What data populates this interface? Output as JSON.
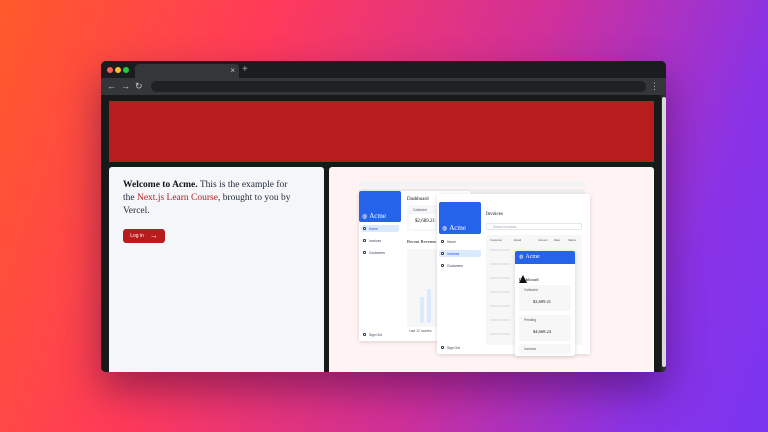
{
  "browser": {
    "tab_close": "×",
    "new_tab": "+",
    "back": "←",
    "forward": "→",
    "reload": "↻",
    "menu": "⋮"
  },
  "hero": {
    "color": "#b91c1c"
  },
  "welcome": {
    "lead": "Welcome to Acme.",
    "text1": " This is the example for the ",
    "link": "Next.js Learn Course",
    "text2": ", brought to you by Vercel."
  },
  "login": {
    "label": "Log in",
    "arrow": "→"
  },
  "preview": {
    "desktop": {
      "logo": "Acme",
      "nav": [
        "Home",
        "Invoices",
        "Customers"
      ],
      "signout": "Sign Out",
      "title": "Dashboard",
      "card_label": "Collected",
      "card_value": "$2,689.21",
      "chart_title": "Recent Revenue",
      "chart_footer": "Last 12 months"
    },
    "tablet": {
      "logo": "Acme",
      "nav": [
        "Home",
        "Invoices",
        "Customers"
      ],
      "signout": "Sign Out",
      "title": "Invoices",
      "search": "Search invoices...",
      "columns": [
        "Customer",
        "Email",
        "Amount",
        "Date",
        "Status"
      ]
    },
    "mobile": {
      "logo": "Acme",
      "title": "Dashboard",
      "cards": [
        {
          "label": "Collected",
          "value": "$2,689.21"
        },
        {
          "label": "Pending",
          "value": "$4,668.24"
        },
        {
          "label": "Invoices",
          "value": ""
        }
      ]
    }
  }
}
